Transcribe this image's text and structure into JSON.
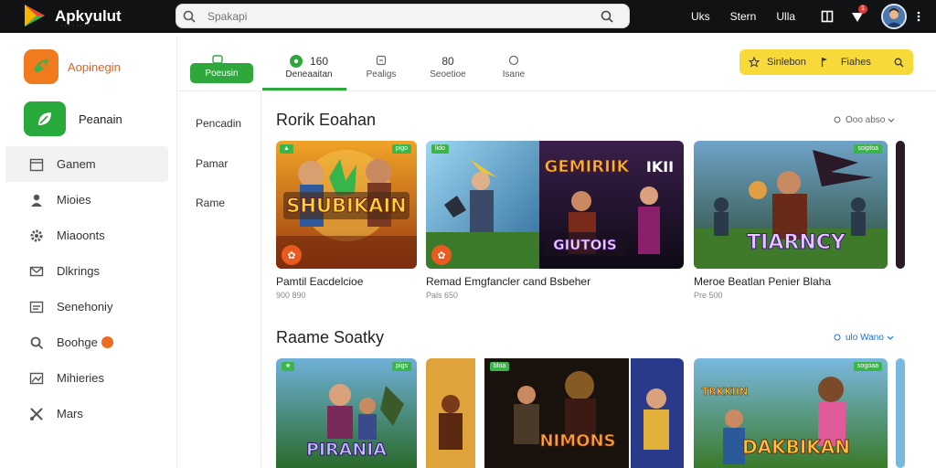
{
  "header": {
    "logo_text": "Apkyulut",
    "logo_sub": "· · · · · · · · ·",
    "search_placeholder": "Spakapi",
    "nav": [
      "Uks",
      "Stern",
      "Ulla"
    ],
    "notification_count": "1"
  },
  "sidebar": {
    "brand_label": "Aopinegin",
    "featured_label": "Peanain",
    "items": [
      {
        "label": "Ganem",
        "icon": "calendar-icon",
        "active": true
      },
      {
        "label": "Mioies",
        "icon": "person-icon"
      },
      {
        "label": "Miaoonts",
        "icon": "gear-icon"
      },
      {
        "label": "Dlkrings",
        "icon": "mail-icon"
      },
      {
        "label": "Senehoniy",
        "icon": "list-icon"
      },
      {
        "label": "Boohge",
        "icon": "search-icon",
        "badge": true
      },
      {
        "label": "Mihieries",
        "icon": "image-icon"
      },
      {
        "label": "Mars",
        "icon": "tools-icon"
      }
    ]
  },
  "tabs": {
    "pill_label": "Poeusin",
    "items": [
      {
        "top": "160",
        "label": "Deneaaitan",
        "active": true
      },
      {
        "top": "",
        "label": "Pealigs"
      },
      {
        "top": "80",
        "label": "Seoetioe"
      },
      {
        "top": "",
        "label": "Isane"
      }
    ],
    "promo_left": "Sinlebon",
    "promo_right": "Fiahes"
  },
  "subnav": {
    "items": [
      "Pencadin",
      "Pamar",
      "Rame"
    ]
  },
  "sections": [
    {
      "title": "Rorik Eoahan",
      "link": "Ooo abso",
      "cards": [
        {
          "title": "Pamtil Eacdelcioe",
          "meta": "900 890",
          "tag": "pigo",
          "art_text": "SHUBIKAIN"
        },
        {
          "title": "Remad Emgfancler cand Bsbeher",
          "meta": "Pals 650",
          "tag": "lido",
          "art_text": "GEMIRIIK"
        },
        {
          "title": "Meroe Beatlan Penier Blaha",
          "meta": "Pre 500",
          "tag": "soiptoa",
          "art_text": "TIARNCY"
        }
      ]
    },
    {
      "title": "Raame Soatky",
      "link": "ulo   Wano",
      "cards": [
        {
          "title": "",
          "meta": "",
          "tag": "pigs",
          "art_text": "PIRANIA"
        },
        {
          "title": "",
          "meta": "",
          "tag": "bloa",
          "art_text": "NIMONS"
        },
        {
          "title": "",
          "meta": "",
          "tag": "sogoaa",
          "art_text": "DAKBIKAN"
        }
      ]
    }
  ],
  "colors": {
    "accent_green": "#2ea83c",
    "brand_orange": "#f07a1e",
    "promo_yellow": "#f7d93a",
    "topbar": "#111214"
  }
}
